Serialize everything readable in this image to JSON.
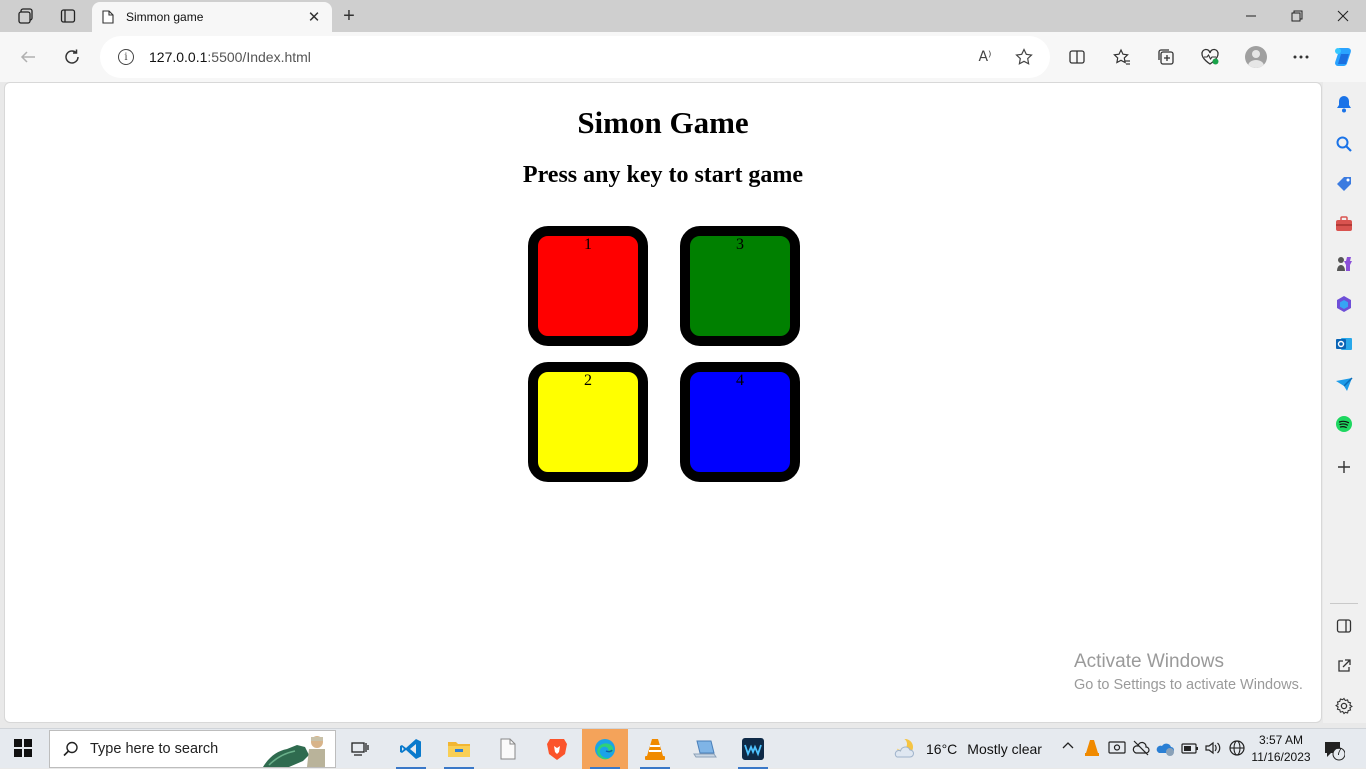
{
  "browser": {
    "tab": {
      "title": "Simmon game",
      "close_label": "✕"
    },
    "new_tab_label": "+",
    "window_controls": {
      "minimize": "—",
      "maximize": "⧉",
      "close": "✕"
    },
    "address": {
      "host": "127.0.0.1",
      "path": ":5500/Index.html"
    },
    "read_aloud_label": "A⁾"
  },
  "page": {
    "title": "Simon Game",
    "subtitle": "Press any key to start game",
    "buttons": [
      {
        "label": "1",
        "color": "#ff0000"
      },
      {
        "label": "3",
        "color": "#008000"
      },
      {
        "label": "2",
        "color": "#ffff00"
      },
      {
        "label": "4",
        "color": "#0000ff"
      }
    ]
  },
  "watermark": {
    "line1": "Activate Windows",
    "line2": "Go to Settings to activate Windows."
  },
  "taskbar": {
    "search_placeholder": "Type here to search",
    "weather": {
      "temp": "16°C",
      "condition": "Mostly clear"
    },
    "clock": {
      "time": "3:57 AM",
      "date": "11/16/2023"
    },
    "notification_count": "7"
  },
  "colors": {
    "edge_accent": "#0f6cbd",
    "copilot_blue": "#2aa3ff",
    "taskbar_highlight": "#f4a35a"
  }
}
